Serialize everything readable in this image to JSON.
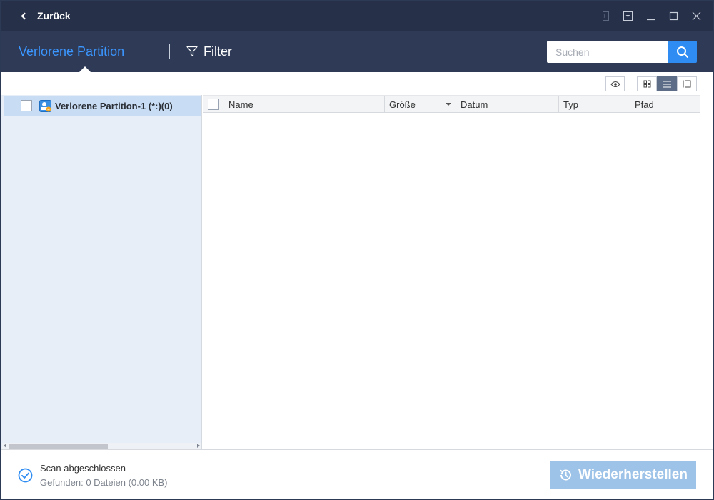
{
  "titlebar": {
    "back_label": "Zurück",
    "controls": [
      "exit-icon",
      "dropdown-menu-icon",
      "minimize-icon",
      "maximize-icon",
      "close-icon"
    ]
  },
  "header": {
    "active_tab": "Verlorene Partition",
    "filter_label": "Filter",
    "search_placeholder": "Suchen",
    "accent_color": "#3b96ff",
    "background_color": "#2e3a56"
  },
  "toolbar": {
    "buttons": [
      "preview-icon",
      "grid-view-icon",
      "list-view-icon",
      "detail-view-icon"
    ],
    "active_view": "list-view"
  },
  "tree": {
    "items": [
      {
        "label": "Verlorene Partition-1 (*:)(0)",
        "checked": false,
        "icon": "partition-icon"
      }
    ]
  },
  "filelist": {
    "columns": {
      "name": "Name",
      "size": "Größe",
      "date": "Datum",
      "type": "Typ",
      "path": "Pfad"
    },
    "rows": []
  },
  "footer": {
    "status_title": "Scan abgeschlossen",
    "status_sub": "Gefunden: 0 Dateien (0.00 KB)",
    "restore_label": "Wiederherstellen",
    "restore_color": "#9ec3e8"
  }
}
